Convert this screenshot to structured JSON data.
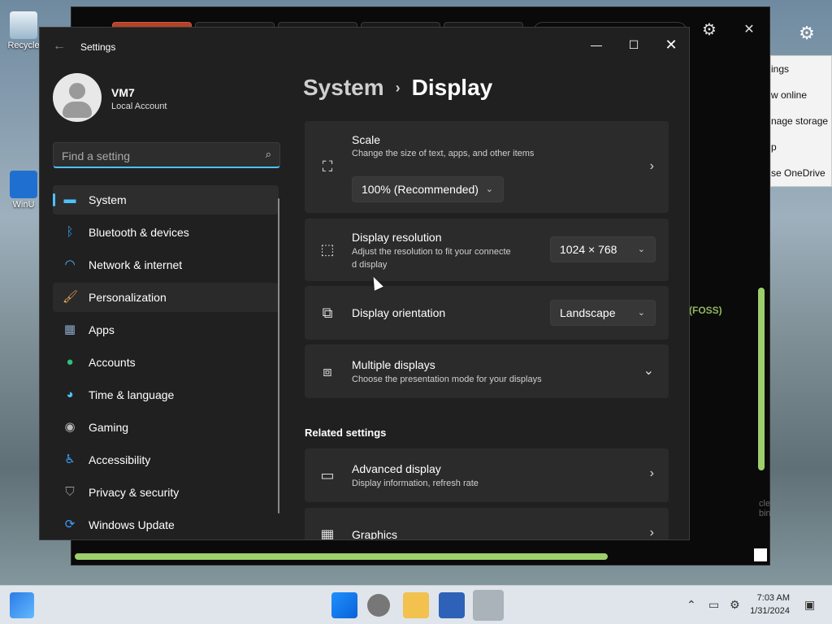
{
  "desktop": {
    "recycle_label": "Recycle",
    "winui_label": "WinU"
  },
  "background_app": {
    "foss_text": "(FOSS)",
    "bin_hint": "cle bin"
  },
  "onedrive_flyout": {
    "items": [
      "ings",
      "w online",
      "nage storage",
      "p",
      "se OneDrive"
    ]
  },
  "settings": {
    "window_title": "Settings",
    "controls": {
      "minimize": "—",
      "maximize": "☐",
      "close": "✕"
    },
    "user": {
      "name": "VM7",
      "account_type": "Local Account"
    },
    "search": {
      "placeholder": "Find a setting"
    },
    "nav": [
      {
        "label": "System",
        "icon": "monitor-icon",
        "color": "#4cc2ff"
      },
      {
        "label": "Bluetooth & devices",
        "icon": "bluetooth-icon",
        "color": "#3a96dd"
      },
      {
        "label": "Network & internet",
        "icon": "wifi-icon",
        "color": "#4cc2ff"
      },
      {
        "label": "Personalization",
        "icon": "brush-icon",
        "color": "#e8a25f"
      },
      {
        "label": "Apps",
        "icon": "apps-icon",
        "color": "#8aa6c8"
      },
      {
        "label": "Accounts",
        "icon": "person-icon",
        "color": "#2ec27e"
      },
      {
        "label": "Time & language",
        "icon": "globe-clock-icon",
        "color": "#4cc2ff"
      },
      {
        "label": "Gaming",
        "icon": "gamepad-icon",
        "color": "#bbbbbb"
      },
      {
        "label": "Accessibility",
        "icon": "accessibility-icon",
        "color": "#3aa0ff"
      },
      {
        "label": "Privacy & security",
        "icon": "shield-icon",
        "color": "#9a9a9a"
      },
      {
        "label": "Windows Update",
        "icon": "update-icon",
        "color": "#3aa0ff"
      }
    ],
    "breadcrumb": {
      "parent": "System",
      "separator": "›",
      "current": "Display"
    },
    "scale": {
      "title": "Scale",
      "subtitle": "Change the size of text, apps, and other items",
      "value": "100% (Recommended)"
    },
    "resolution": {
      "title": "Display resolution",
      "subtitle_line1": "Adjust the resolution to fit your connecte",
      "subtitle_line2": "d display",
      "value": "1024 × 768"
    },
    "orientation": {
      "title": "Display orientation",
      "value": "Landscape"
    },
    "multiple": {
      "title": "Multiple displays",
      "subtitle": "Choose the presentation mode for your displays"
    },
    "related_header": "Related settings",
    "advanced": {
      "title": "Advanced display",
      "subtitle": "Display information, refresh rate"
    },
    "graphics": {
      "title": "Graphics"
    }
  },
  "taskbar": {
    "time": "7:03 AM",
    "date": "1/31/2024"
  },
  "colors": {
    "accent": "#4cc2ff",
    "window_bg": "#202020",
    "card_bg": "#2b2b2b",
    "scroll_green": "#9ccf6c"
  }
}
